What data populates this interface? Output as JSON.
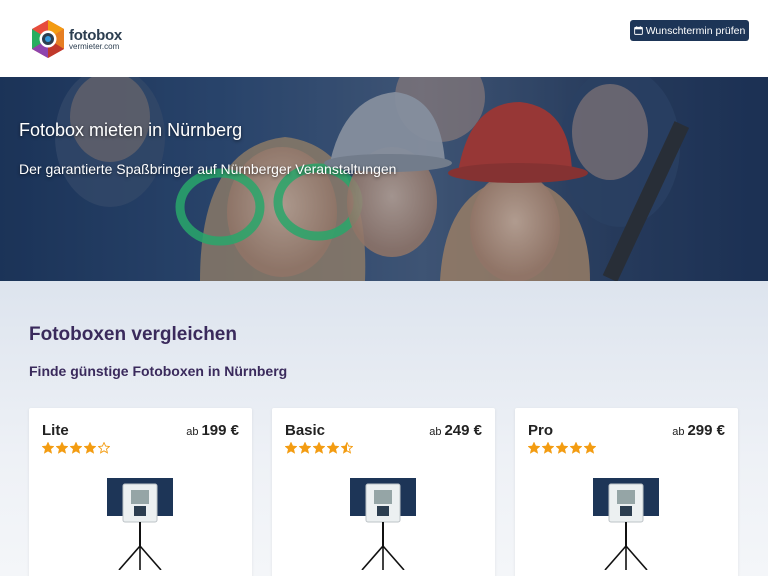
{
  "header": {
    "logo": {
      "main": "fotobox",
      "sub": "vermieter.com"
    },
    "cta_label": "Wunschtermin prüfen"
  },
  "hero": {
    "title": "Fotobox mieten in Nürnberg",
    "subtitle": "Der garantierte Spaßbringer auf Nürnberger Veranstaltungen"
  },
  "main": {
    "title": "Fotoboxen vergleichen",
    "subtitle": "Finde günstige Fotoboxen in Nürnberg",
    "cards": [
      {
        "name": "Lite",
        "price_prefix": "ab",
        "price": "199 €",
        "rating": 4.0
      },
      {
        "name": "Basic",
        "price_prefix": "ab",
        "price": "249 €",
        "rating": 4.5
      },
      {
        "name": "Pro",
        "price_prefix": "ab",
        "price": "299 €",
        "rating": 5.0
      }
    ]
  },
  "colors": {
    "star": "#f39c12",
    "cta_bg": "#1d3557",
    "heading": "#3a2a5c"
  },
  "icons": {
    "cta": "calendar-icon",
    "logo": "camera-hexagon-icon"
  }
}
